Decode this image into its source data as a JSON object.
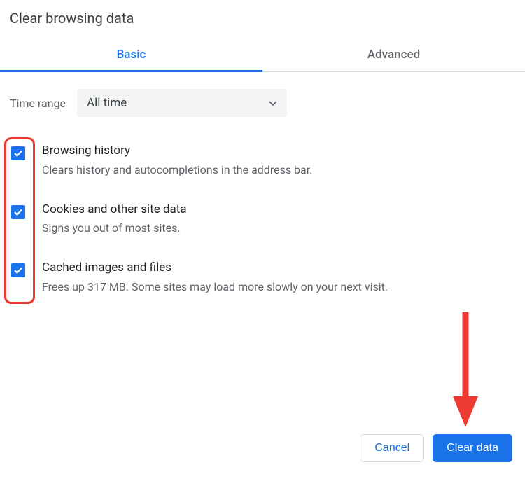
{
  "dialog": {
    "title": "Clear browsing data"
  },
  "tabs": {
    "basic": "Basic",
    "advanced": "Advanced"
  },
  "time_range": {
    "label": "Time range",
    "value": "All time"
  },
  "options": {
    "browsing_history": {
      "title": "Browsing history",
      "desc": "Clears history and autocompletions in the address bar.",
      "checked": true
    },
    "cookies": {
      "title": "Cookies and other site data",
      "desc": "Signs you out of most sites.",
      "checked": true
    },
    "cache": {
      "title": "Cached images and files",
      "desc": "Frees up 317 MB. Some sites may load more slowly on your next visit.",
      "checked": true
    }
  },
  "buttons": {
    "cancel": "Cancel",
    "clear": "Clear data"
  },
  "colors": {
    "accent": "#1a73e8",
    "annotation": "#ed3b33"
  }
}
